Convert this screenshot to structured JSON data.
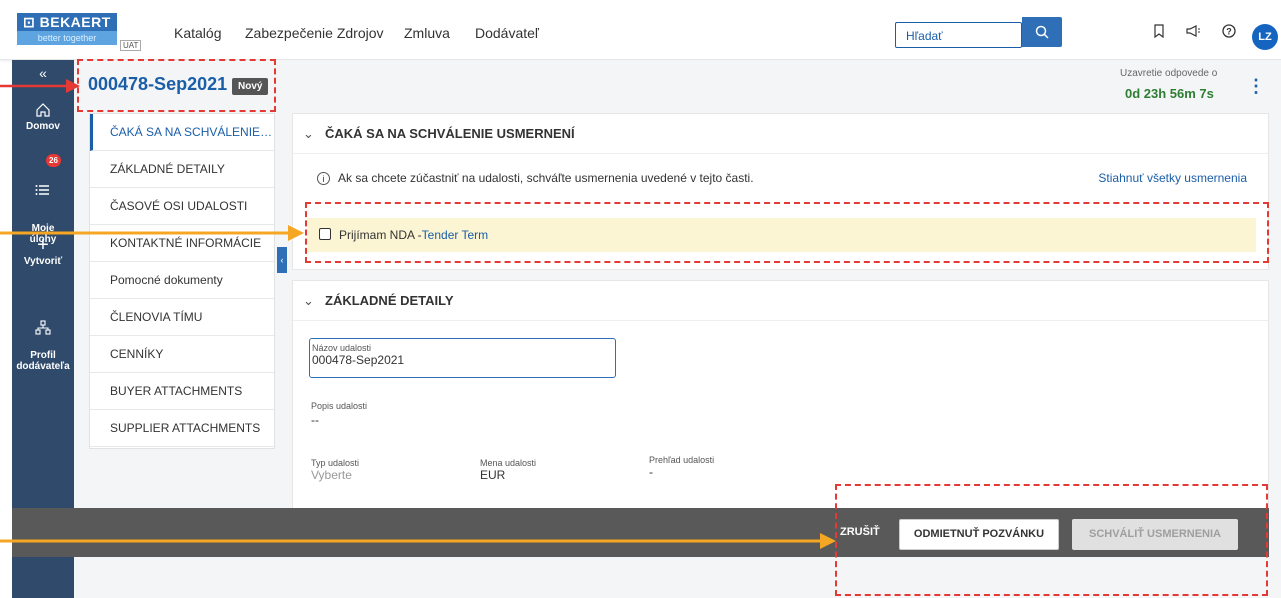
{
  "brand": {
    "name": "BEKAERT",
    "tagline": "better together",
    "env": "UAT"
  },
  "topnav": [
    "Katalóg",
    "Zabezpečenie Zdrojov",
    "Zmluva",
    "Dodávateľ"
  ],
  "search": {
    "placeholder": "Hľadať"
  },
  "user": {
    "initials": "LZ"
  },
  "rail": {
    "collapse": "«",
    "items": [
      {
        "label": "Domov",
        "icon": "home-icon"
      },
      {
        "label": "Moje\núlohy",
        "icon": "tasks-icon",
        "badge": "26"
      },
      {
        "label": "Vytvoriť",
        "icon": "plus-icon"
      },
      {
        "label": "Profil\ndodávateľa",
        "icon": "org-chart-icon"
      }
    ]
  },
  "event": {
    "id": "000478-Sep2021",
    "status": "Nový",
    "deadline_label": "Uzavretie odpovede o",
    "deadline_value": "0d 23h 56m 7s"
  },
  "sections": [
    "ČAKÁ SA NA SCHVÁLENIE USMERNENÍ",
    "ZÁKLADNÉ DETAILY",
    "ČASOVÉ OSI UDALOSTI",
    "KONTAKTNÉ INFORMÁCIE",
    "Pomocné dokumenty",
    "ČLENOVIA TÍMU",
    "CENNÍKY",
    "BUYER ATTACHMENTS",
    "SUPPLIER ATTACHMENTS"
  ],
  "approval": {
    "title": "ČAKÁ SA NA SCHVÁLENIE USMERNENÍ",
    "info": "Ak sa chcete zúčastniť na udalosti, schváľte usmernenia uvedené v tejto časti.",
    "download_link": "Stiahnuť všetky usmernenia",
    "nda_label": "Prijímam NDA -",
    "nda_link": "Tender Term"
  },
  "details": {
    "title": "ZÁKLADNÉ DETAILY",
    "name_label": "Názov udalosti",
    "name_value": "000478-Sep2021",
    "desc_label": "Popis udalosti",
    "desc_value": "--",
    "type_label": "Typ udalosti",
    "type_value": "Vyberte",
    "currency_label": "Mena udalosti",
    "currency_value": "EUR",
    "overview_label": "Prehľad udalosti",
    "overview_value": "-"
  },
  "actions": {
    "cancel": "ZRUŠIŤ",
    "decline": "ODMIETNUŤ POZVÁNKU",
    "approve": "SCHVÁLIŤ USMERNENIA"
  },
  "colors": {
    "primary": "#1a5ea8",
    "rail": "#2f4a6b",
    "annotation": "#e53935",
    "arrow": "#f5a623"
  }
}
